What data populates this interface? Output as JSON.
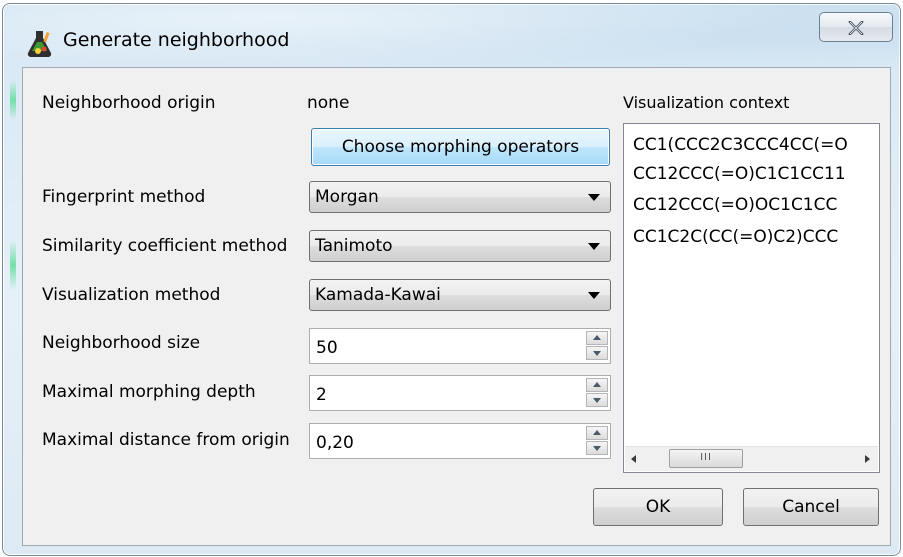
{
  "window": {
    "title": "Generate neighborhood",
    "close_icon": "close-x-icon",
    "app_icon": "flask-app-icon"
  },
  "form": {
    "origin_label": "Neighborhood origin",
    "origin_value": "none",
    "choose_operators_button": "Choose morphing operators",
    "fingerprint_label": "Fingerprint method",
    "fingerprint_value": "Morgan",
    "similarity_label": "Similarity coefficient method",
    "similarity_value": "Tanimoto",
    "visualization_label": "Visualization method",
    "visualization_value": "Kamada-Kawai",
    "size_label": "Neighborhood size",
    "size_value": "50",
    "depth_label": "Maximal morphing depth",
    "depth_value": "2",
    "distance_label": "Maximal distance from origin",
    "distance_value": "0,20"
  },
  "context": {
    "label": "Visualization context",
    "items": [
      "CC1(CCC2C3CCC4CC(=O",
      "CC12CCC(=O)C1C1CC11",
      "CC12CCC(=O)OC1C1CC",
      "CC1C2C(CC(=O)C2)CCC"
    ],
    "scroll_thumb_mark": "III"
  },
  "buttons": {
    "ok": "OK",
    "cancel": "Cancel"
  },
  "colors": {
    "frame_accent": "#cfe3f2",
    "focus_button": "#bee6fd",
    "client_bg": "#f0f0f0"
  }
}
